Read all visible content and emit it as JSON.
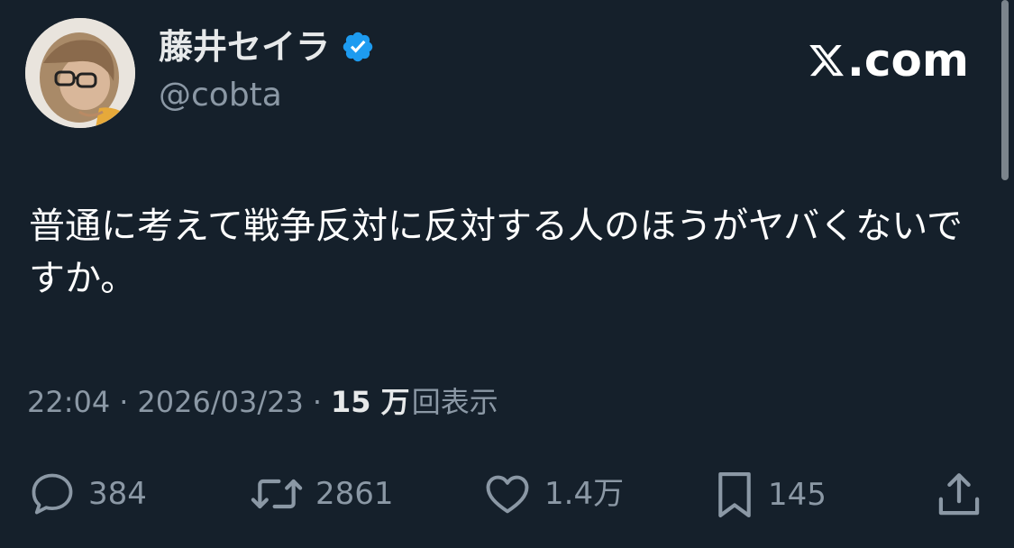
{
  "author": {
    "display_name": "藤井セイラ",
    "handle": "@cobta"
  },
  "brand": {
    "label": ".com"
  },
  "tweet": {
    "text": "普通に考えて戦争反対に反対する人のほうがヤバくないですか。"
  },
  "meta": {
    "time": "22:04",
    "separator": "·",
    "date": "2026/03/23",
    "views_count": "15 万",
    "views_label": "回表示"
  },
  "actions": {
    "replies": "384",
    "retweets": "2861",
    "likes": "1.4万",
    "bookmarks": "145"
  },
  "colors": {
    "background": "#15202b",
    "secondary_text": "#8b98a5",
    "verified": "#1d9bf0"
  },
  "icons": {
    "verified": "verified-badge-icon",
    "brand": "x-logo-icon",
    "reply": "speech-bubble-icon",
    "retweet": "retweet-arrows-icon",
    "like": "heart-icon",
    "bookmark": "bookmark-icon",
    "share": "share-upload-icon"
  }
}
